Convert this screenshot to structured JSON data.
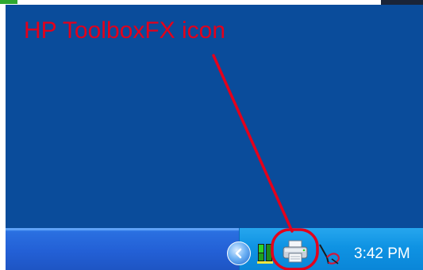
{
  "annotation": {
    "label": "HP ToolboxFX icon",
    "color": "#e3001b"
  },
  "desktop": {
    "background_color": "#0a4c9b"
  },
  "taskbar": {
    "tray": {
      "icons": [
        "chevron-left-icon",
        "network-status-icon",
        "hp-toolboxfx-printer-icon",
        "pen-tablet-icon"
      ],
      "clock": "3:42 PM"
    }
  }
}
